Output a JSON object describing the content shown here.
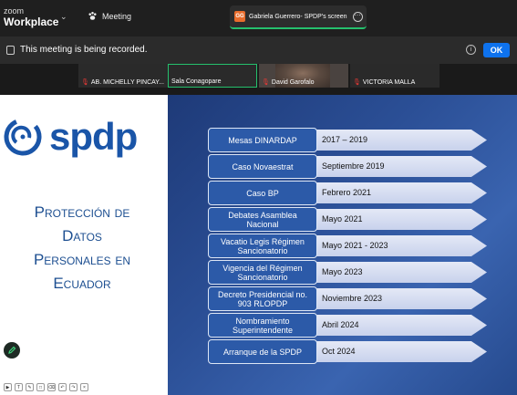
{
  "app": {
    "brand_top": "zoom",
    "brand_bottom": "Workplace",
    "meeting_label": "Meeting"
  },
  "share": {
    "initials": "GG",
    "title": "Gabriela Guerrero- SPDP's screen"
  },
  "recording": {
    "message": "This meeting is being recorded.",
    "ok_label": "OK"
  },
  "participants": [
    "AB. MICHELLY PINCAY...",
    "Sala Conagopare",
    "David Garofalo",
    "VICTORIA MALLA"
  ],
  "slide": {
    "logo_text": "spdp",
    "title_lines": [
      "Protección de",
      "Datos",
      "Personales en",
      "Ecuador"
    ],
    "timeline": [
      {
        "label": "Mesas DINARDAP",
        "date": "2017 – 2019"
      },
      {
        "label": "Caso Novaestrat",
        "date": "Septiembre 2019"
      },
      {
        "label": "Caso BP",
        "date": "Febrero 2021"
      },
      {
        "label": "Debates Asamblea Nacional",
        "date": "Mayo 2021"
      },
      {
        "label": "Vacatio Legis Régimen Sancionatorio",
        "date": "Mayo 2021 - 2023"
      },
      {
        "label": "Vigencia del Régimen Sancionatorio",
        "date": "Mayo 2023"
      },
      {
        "label": "Decreto Presidencial no. 903 RLOPDP",
        "date": "Noviembre 2023"
      },
      {
        "label": "Nombramiento Superintendente",
        "date": "Abril 2024"
      },
      {
        "label": "Arranque de la SPDP",
        "date": "Oct 2024"
      }
    ]
  },
  "colors": {
    "ok_button": "#0e72ed",
    "slide_bg": "#2b4f96",
    "pill": "#2c5aa8",
    "logo": "#1a55a8"
  }
}
